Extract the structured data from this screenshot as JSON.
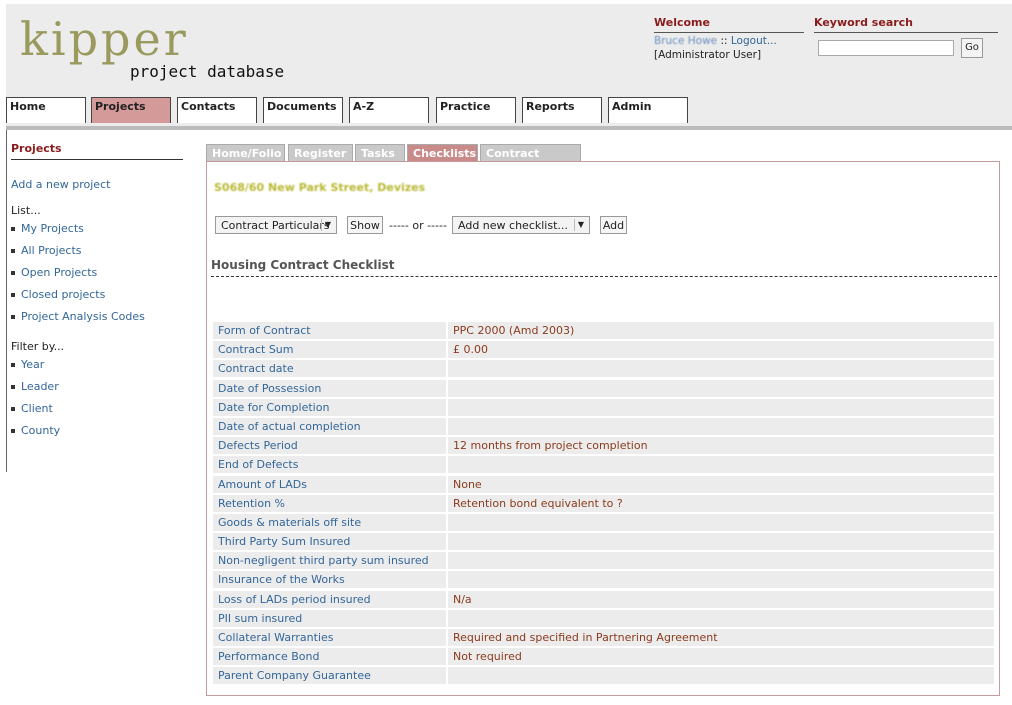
{
  "header": {
    "logo_main": "kipper",
    "logo_sub": "project database",
    "welcome_title": "Welcome",
    "user_name": "Bruce Howe",
    "logout_label": "Logout...",
    "user_role": "[Administrator User]",
    "keyword_title": "Keyword search",
    "search_value": "",
    "go_label": "Go"
  },
  "nav": {
    "tabs": [
      "Home",
      "Projects",
      "Contacts",
      "Documents",
      "A-Z",
      "Practice",
      "Reports",
      "Admin"
    ],
    "active": "Projects"
  },
  "sidebar": {
    "heading": "Projects",
    "add_project": "Add a new project",
    "list_label": "List...",
    "list_items": [
      "My Projects",
      "All Projects",
      "Open Projects",
      "Closed projects",
      "Project Analysis Codes"
    ],
    "filter_label": "Filter by...",
    "filter_items": [
      "Year",
      "Leader",
      "Client",
      "County"
    ]
  },
  "content_tabs": {
    "tabs": [
      "Home/Folio",
      "Register",
      "Tasks",
      "Checklists",
      "Contract Admin"
    ],
    "active": "Checklists"
  },
  "project_title": "S068/60 New Park Street, Devizes",
  "controls": {
    "select_checklist": "Contract Particulars",
    "show_label": "Show",
    "or_label": "----- or -----",
    "add_select": "Add new checklist...",
    "add_label": "Add"
  },
  "checklist": {
    "title": "Housing Contract Checklist",
    "rows": [
      {
        "key": "Form of Contract",
        "value": "PPC 2000 (Amd 2003)"
      },
      {
        "key": "Contract Sum",
        "value": "£ 0.00"
      },
      {
        "key": "Contract date",
        "value": ""
      },
      {
        "key": "Date of Possession",
        "value": ""
      },
      {
        "key": "Date for Completion",
        "value": ""
      },
      {
        "key": "Date of actual completion",
        "value": ""
      },
      {
        "key": "Defects Period",
        "value": "12 months from project completion"
      },
      {
        "key": "End of Defects",
        "value": ""
      },
      {
        "key": "Amount of LADs",
        "value": "None"
      },
      {
        "key": "Retention %",
        "value": "Retention bond equivalent to ?"
      },
      {
        "key": "Goods & materials off site",
        "value": ""
      },
      {
        "key": "Third Party Sum Insured",
        "value": ""
      },
      {
        "key": "Non-negligent third party sum insured",
        "value": ""
      },
      {
        "key": "Insurance of the Works",
        "value": ""
      },
      {
        "key": "Loss of LADs period insured",
        "value": "N/a"
      },
      {
        "key": "PII sum insured",
        "value": ""
      },
      {
        "key": "Collateral Warranties",
        "value": "Required and specified in Partnering Agreement"
      },
      {
        "key": "Performance Bond",
        "value": "Not required"
      },
      {
        "key": "Parent Company Guarantee",
        "value": ""
      }
    ]
  },
  "colors": {
    "accent": "#8b1c1c",
    "active_tab": "#d49a9a",
    "link": "#336699",
    "value_text": "#8a3b1d"
  }
}
